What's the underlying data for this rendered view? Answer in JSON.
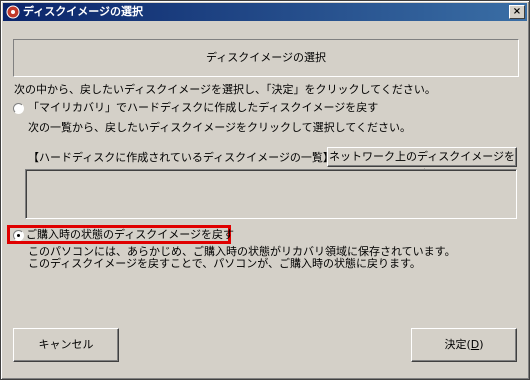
{
  "window": {
    "title": "ディスクイメージの選択",
    "close_label": "×"
  },
  "header": {
    "title": "ディスクイメージの選択"
  },
  "instructions": "次の中から、戻したいディスクイメージを選択し、「決定」をクリックしてください。",
  "option_restore_created": {
    "label": "「マイリカバリ」でハードディスクに作成したディスクイメージを戻す",
    "description": "次の一覧から、戻したいディスクイメージをクリックして選択してください。",
    "checked": false
  },
  "disk_image_list": {
    "label": "【ハードディスクに作成されているディスクイメージの一覧】",
    "network_button_label": "ネットワーク上のディスクイメージを選択"
  },
  "option_restore_purchase": {
    "label": "ご購入時の状態のディスクイメージを戻す",
    "description_line1": "このパソコンには、あらかじめ、ご購入時の状態がリカバリ領域に保存されています。",
    "description_line2": "このディスクイメージを戻すことで、パソコンが、ご購入時の状態に戻ります。",
    "checked": true,
    "highlight_color": "#e00000"
  },
  "buttons": {
    "cancel": "キャンセル",
    "ok": "決定(",
    "ok_hotkey": "D",
    "ok_suffix": ")"
  },
  "colors": {
    "title_bar": "#0a246a",
    "face": "#d4d0c8"
  }
}
